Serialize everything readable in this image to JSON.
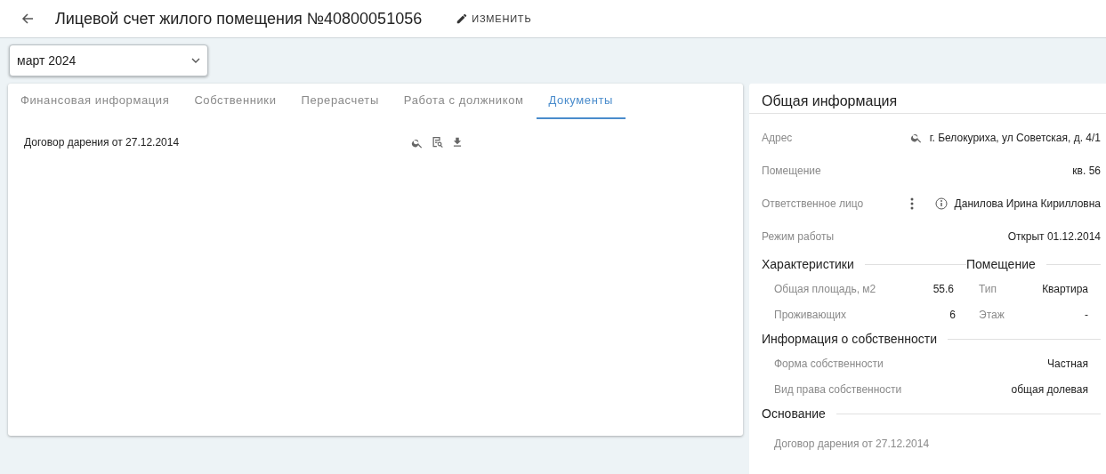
{
  "header": {
    "title": "Лицевой счет жилого помещения №40800051056",
    "edit_label": "ИЗМЕНИТЬ"
  },
  "period": {
    "value": "март 2024"
  },
  "tabs": [
    {
      "label": "Финансовая информация",
      "selected": false
    },
    {
      "label": "Собственники",
      "selected": false
    },
    {
      "label": "Перерасчеты",
      "selected": false
    },
    {
      "label": "Работа с должником",
      "selected": false
    },
    {
      "label": "Документы",
      "selected": true
    }
  ],
  "documents": [
    {
      "name": "Договор дарения от 27.12.2014"
    }
  ],
  "info": {
    "title": "Общая информация",
    "rows": [
      {
        "kind": "address",
        "label": "Адрес",
        "value": "г. Белокуриха, ул Советская, д. 4/1"
      },
      {
        "kind": "plain",
        "label": "Помещение",
        "value": "кв. 56"
      },
      {
        "kind": "person",
        "label": "Ответственное лицо",
        "value": "Данилова Ирина Кирилловна"
      },
      {
        "kind": "plain",
        "label": "Режим работы",
        "value": "Открыт 01.12.2014"
      }
    ],
    "characteristics": {
      "title": "Характеристики",
      "rows": [
        {
          "label": "Общая площадь, м2",
          "value": "55.6"
        },
        {
          "label": "Проживающих",
          "value": "6"
        }
      ]
    },
    "premises": {
      "title": "Помещение",
      "rows": [
        {
          "label": "Тип",
          "value": "Квартира"
        },
        {
          "label": "Этаж",
          "value": "-"
        }
      ]
    },
    "ownership": {
      "title": "Информация о собственности",
      "rows": [
        {
          "label": "Форма собственности",
          "value": "Частная"
        },
        {
          "label": "Вид права собственности",
          "value": "общая долевая"
        }
      ]
    },
    "basis": {
      "title": "Основание",
      "rows": [
        {
          "label": "Договор дарения от 27.12.2014"
        }
      ]
    }
  }
}
